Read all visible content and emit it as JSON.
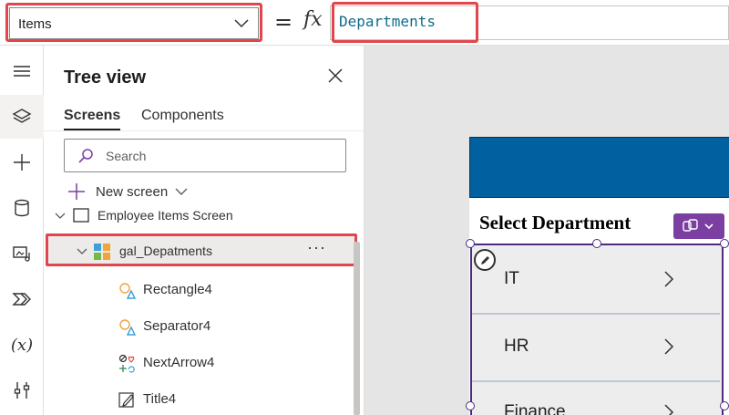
{
  "formula_bar": {
    "property": "Items",
    "equals": "=",
    "fx": "fx",
    "formula": "Departments"
  },
  "rail": {
    "items": [
      "hamburger-icon",
      "layers-icon",
      "plus-icon",
      "database-icon",
      "media-icon",
      "power-automate-icon",
      "variables-icon",
      "tools-icon"
    ],
    "variables_glyph": "(x)"
  },
  "tree_view": {
    "title": "Tree view",
    "tabs": [
      {
        "label": "Screens",
        "active": true
      },
      {
        "label": "Components",
        "active": false
      }
    ],
    "search_placeholder": "Search",
    "new_screen_label": "New screen",
    "nodes": {
      "screen": "Employee Items Screen",
      "gallery": "gal_Depatments",
      "gallery_more": "···",
      "children": [
        "Rectangle4",
        "Separator4",
        "NextArrow4",
        "Title4"
      ]
    }
  },
  "canvas": {
    "title": "Select Department",
    "header_color": "#0060a0",
    "gallery_items": [
      "IT",
      "HR",
      "Finance"
    ]
  },
  "colors": {
    "highlight": "#e0474c",
    "accent_purple": "#7b3fa1",
    "selection": "#4b2b84",
    "formula_text": "#0f6b8a"
  }
}
